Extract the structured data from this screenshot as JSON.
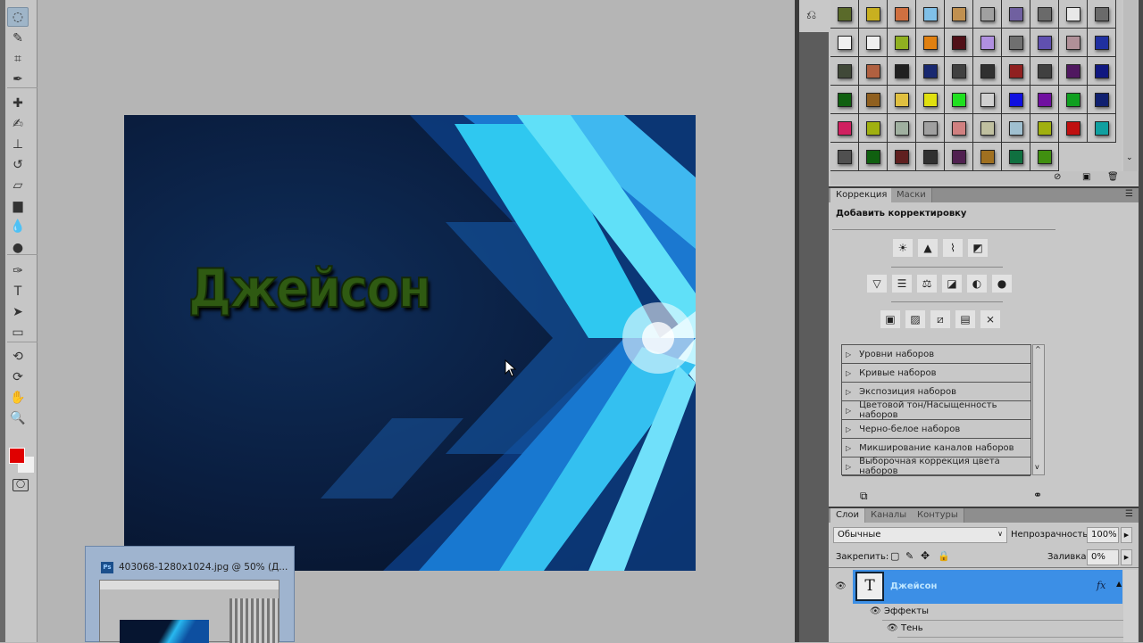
{
  "toolbar": {
    "tools": [
      "lasso",
      "quick-selection",
      "crop",
      "eyedropper",
      "healing-brush",
      "brush",
      "clone-stamp",
      "history-brush",
      "eraser",
      "gradient",
      "blur",
      "dodge",
      "pen",
      "type",
      "path-selection",
      "rectangle",
      "3d-rotate",
      "3d-orbit",
      "hand",
      "zoom"
    ],
    "foreground_color": "#e00000",
    "background_color": "#f0f0f0"
  },
  "canvas": {
    "text": "Джейсон"
  },
  "styles": {
    "swatches": [
      "#5a6a2a",
      "#c8b020",
      "#d07040",
      "#80c0e8",
      "#c09050",
      "#a0a0a0",
      "#7060a0",
      "#6a6a6a",
      "#e8e8e8",
      "#6a6a6a",
      "#f0f0f0",
      "#f0f0f0",
      "#90b020",
      "#e08010",
      "#501018",
      "#b090e0",
      "#707070",
      "#6050b0",
      "#b09098",
      "#2030a0",
      "#404838",
      "#b06040",
      "#202020",
      "#182870",
      "#404040",
      "#303030",
      "#902020",
      "#404040",
      "#501860",
      "#101880",
      "#106010",
      "#906020",
      "#e0c040",
      "#e0e010",
      "#20e020",
      "#d0d0d0",
      "#1010e0",
      "#7010a0",
      "#10a020",
      "#102070",
      "#d02060",
      "#a0b010",
      "#a0b0a0",
      "#a0a0a0",
      "#d08080",
      "#c0c0a0",
      "#a0c0d0",
      "#a0b010",
      "#c01010",
      "#10a0a0",
      "#505050",
      "#106010",
      "#602020",
      "#303030",
      "#502050",
      "#a07020",
      "#107040",
      "#409010"
    ]
  },
  "adjustments": {
    "tab_active": "Коррекция",
    "tab_other": "Маски",
    "heading": "Добавить корректировку",
    "icons_row1": [
      "☀",
      "▲",
      "⌇",
      "◩"
    ],
    "icons_row2": [
      "▽",
      "☰",
      "⚖",
      "◪",
      "◐",
      "●"
    ],
    "icons_row3": [
      "▣",
      "▨",
      "⧄",
      "▤",
      "⨯"
    ],
    "presets": [
      "Уровни наборов",
      "Кривые наборов",
      "Экспозиция наборов",
      "Цветовой тон/Насыщенность наборов",
      "Черно-белое наборов",
      "Микширование каналов наборов",
      "Выборочная коррекция цвета наборов"
    ]
  },
  "layers": {
    "tabs": [
      "Слои",
      "Каналы",
      "Контуры"
    ],
    "blend_mode": "Обычные",
    "opacity_label": "Непрозрачность:",
    "opacity": "100%",
    "lock_label": "Закрепить:",
    "fill_label": "Заливка:",
    "fill": "0%",
    "layer_name": "Джейсон",
    "thumb_glyph": "T",
    "fx": "fx",
    "effects_label": "Эффекты",
    "effect_items": [
      "Тень"
    ]
  },
  "taskbar_preview": {
    "title": "403068-1280x1024.jpg @ 50% (Д...",
    "app_badge": "Ps"
  }
}
